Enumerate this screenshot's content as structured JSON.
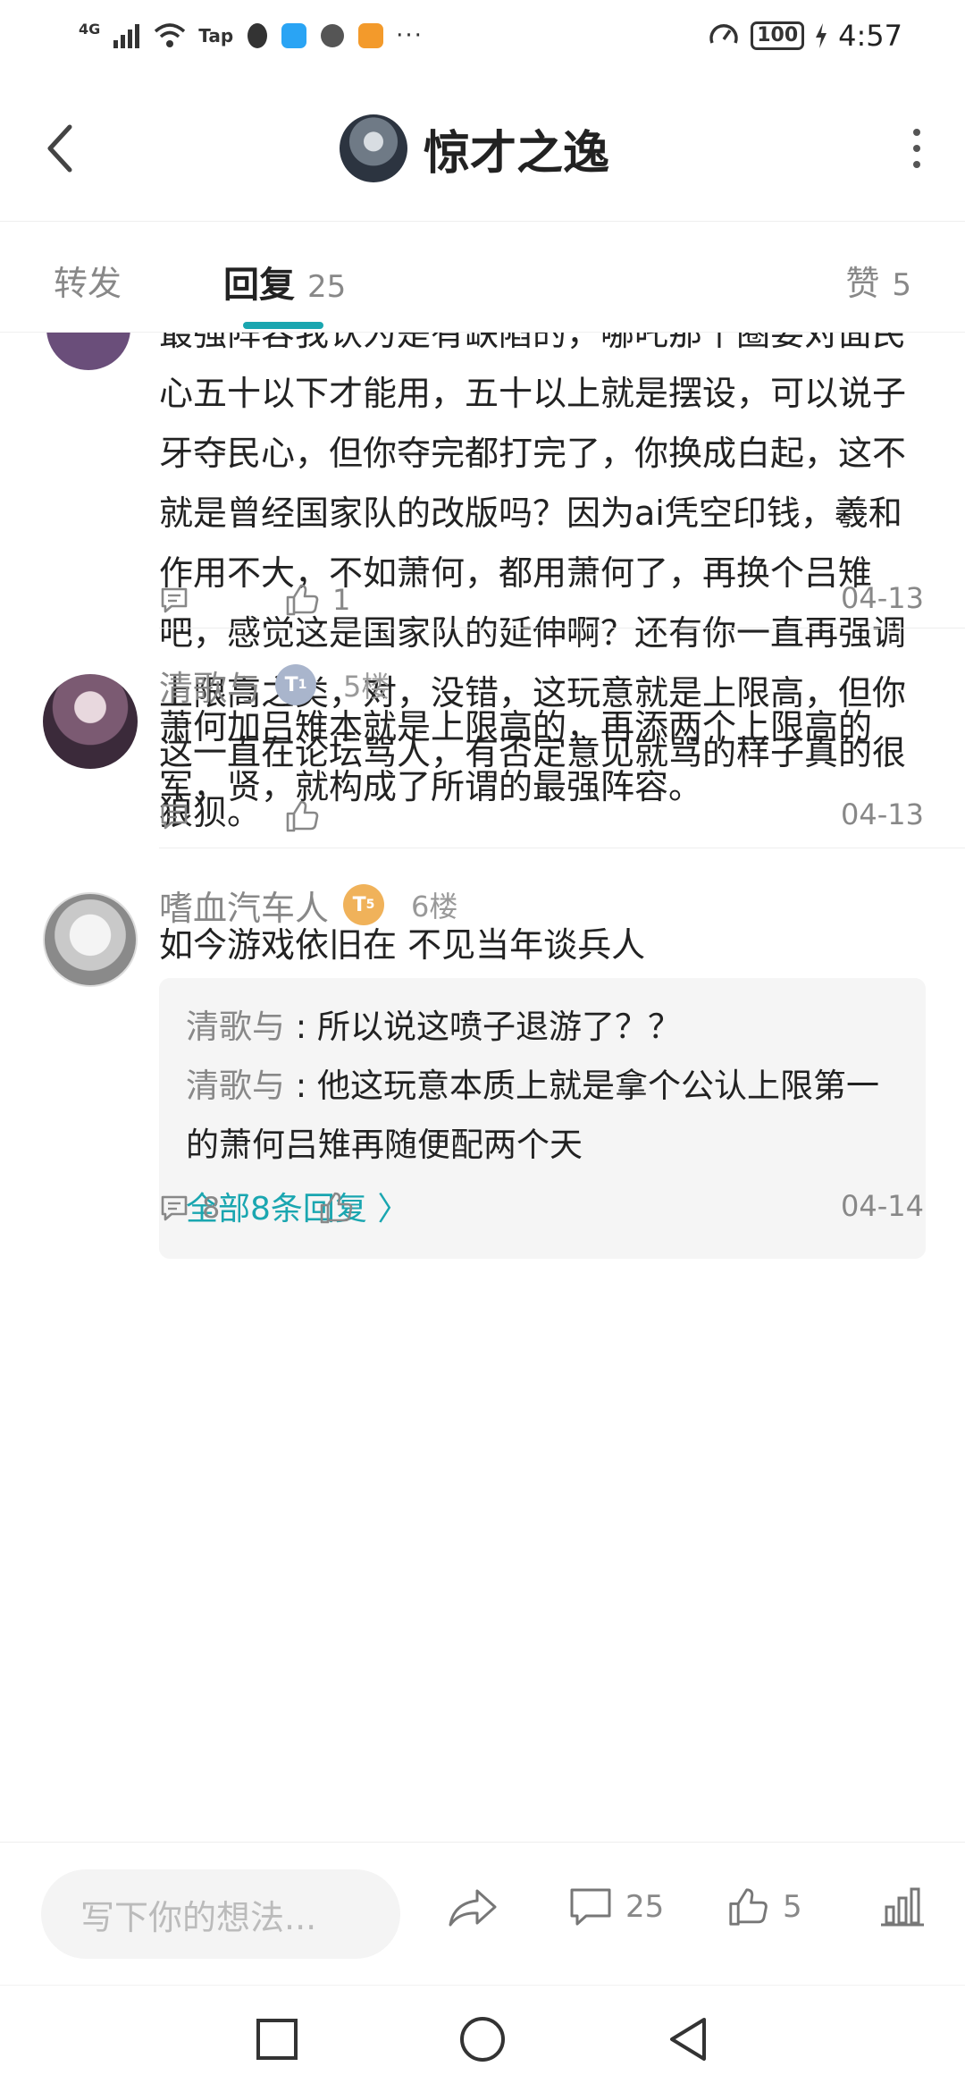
{
  "status": {
    "network": "4G",
    "tap_label": "Tap",
    "more": "···",
    "battery": "100",
    "time": "4:57"
  },
  "header": {
    "title": "惊才之逸"
  },
  "tabs": {
    "repost": "转发",
    "reply": "回复",
    "reply_count": "25",
    "like": "赞",
    "like_count": "5"
  },
  "comments": [
    {
      "text": "最强阵容我认为是有缺陷的，哪吒那个圈要对面民心五十以下才能用，五十以上就是摆设，可以说子牙夺民心，但你夺完都打完了，你换成白起，这不就是曾经国家队的改版吗？因为ai凭空印钱，羲和作用不大，不如萧何，都用萧何了，再换个吕雉吧，感觉这是国家队的延伸啊？还有你一直再强调上限高之类，对，没错，这玩意就是上限高，但你这一直在论坛骂人，有否定意见就骂的样子真的很狼狈。",
      "like_count": "1",
      "date": "04-13"
    },
    {
      "username": "清歌与",
      "level": "1",
      "floor": "5楼",
      "text": "萧何加吕雉本就是上限高的，再添两个上限高的军，贤，就构成了所谓的最强阵容。",
      "date": "04-13"
    },
    {
      "username": "嗜血汽车人",
      "level": "5",
      "floor": "6楼",
      "text": "如今游戏依旧在 不见当年谈兵人",
      "replies": [
        {
          "name": "清歌与",
          "sep": " : ",
          "text": "所以说这喷子退游了？？"
        },
        {
          "name": "清歌与",
          "sep": " : ",
          "text": "他这玩意本质上就是拿个公认上限第一的萧何吕雉再随便配两个天"
        }
      ],
      "more_replies": "全部8条回复 〉",
      "comment_count": "8",
      "date": "04-14"
    }
  ],
  "bottom": {
    "input_placeholder": "写下你的想法...",
    "comment_count": "25",
    "like_count": "5"
  },
  "icons": {
    "accent": "#1aa6b0",
    "muted": "#888888"
  }
}
